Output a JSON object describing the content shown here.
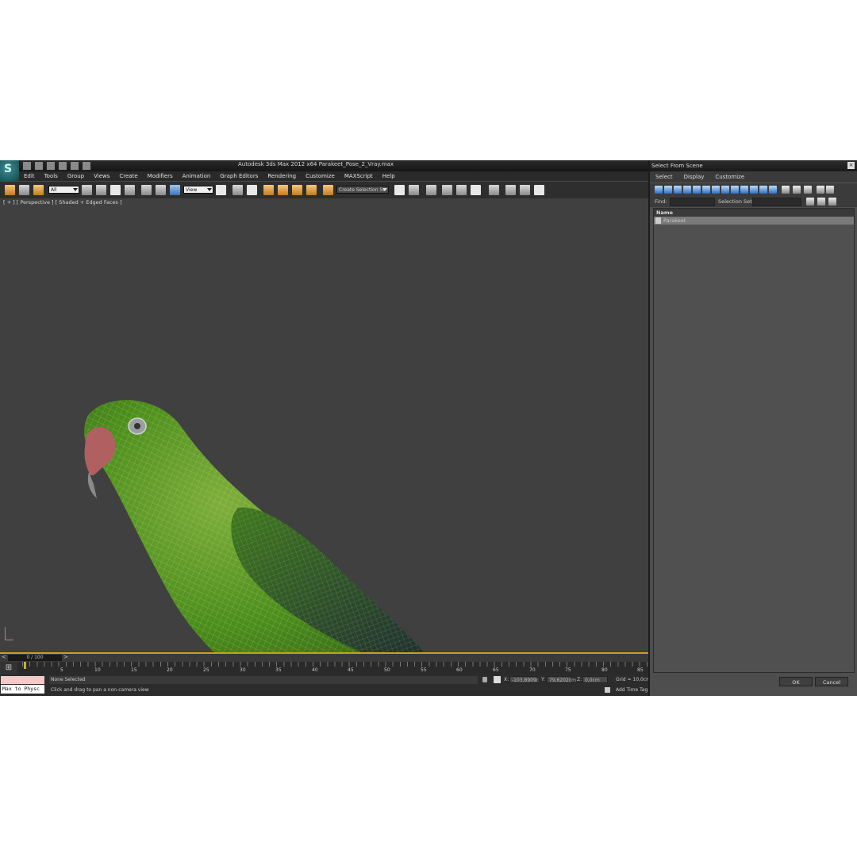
{
  "app": {
    "title": "Autodesk 3ds Max  2012 x64      Parakeet_Pose_2_Vray.max",
    "logo_letter": "S"
  },
  "menu": [
    "Edit",
    "Tools",
    "Group",
    "Views",
    "Create",
    "Modifiers",
    "Animation",
    "Graph Editors",
    "Rendering",
    "Customize",
    "MAXScript",
    "Help"
  ],
  "toolbar": {
    "selection_filter": "All",
    "reference_coord": "View",
    "selection_set": "Create Selection Se"
  },
  "viewport": {
    "label": "[ + ] [ Perspective ] [ Shaded + Edged Faces ]"
  },
  "timeline": {
    "frame_display": "0 / 100",
    "prev": "<",
    "next": ">",
    "ticks": [
      "5",
      "10",
      "15",
      "20",
      "25",
      "30",
      "35",
      "40",
      "45",
      "50",
      "55",
      "60",
      "65",
      "70",
      "75",
      "80",
      "85"
    ]
  },
  "status": {
    "maxscript_listener": "Max to Physc",
    "selection": "None Selected",
    "prompt": "Click and drag to pan a non-camera view",
    "x_label": "X:",
    "x_value": "-103,8909c",
    "y_label": "Y:",
    "y_value": "79,6202cm",
    "z_label": "Z:",
    "z_value": "0,0cm",
    "grid": "Grid = 10,0cm",
    "add_time_tag": "Add Time Tag"
  },
  "dialog": {
    "title": "Select From Scene",
    "close": "×",
    "menu": [
      "Select",
      "Display",
      "Customize"
    ],
    "find_label": "Find:",
    "selection_set_label": "Selection Set:",
    "column_name": "Name",
    "rows": [
      "Parakeet"
    ],
    "ok": "OK",
    "cancel": "Cancel"
  },
  "colors": {
    "viewport_bg": "#404040",
    "active_viewport_border": "#c8a020",
    "parakeet_green": "#4d8f1c",
    "beak": "#b06060"
  }
}
